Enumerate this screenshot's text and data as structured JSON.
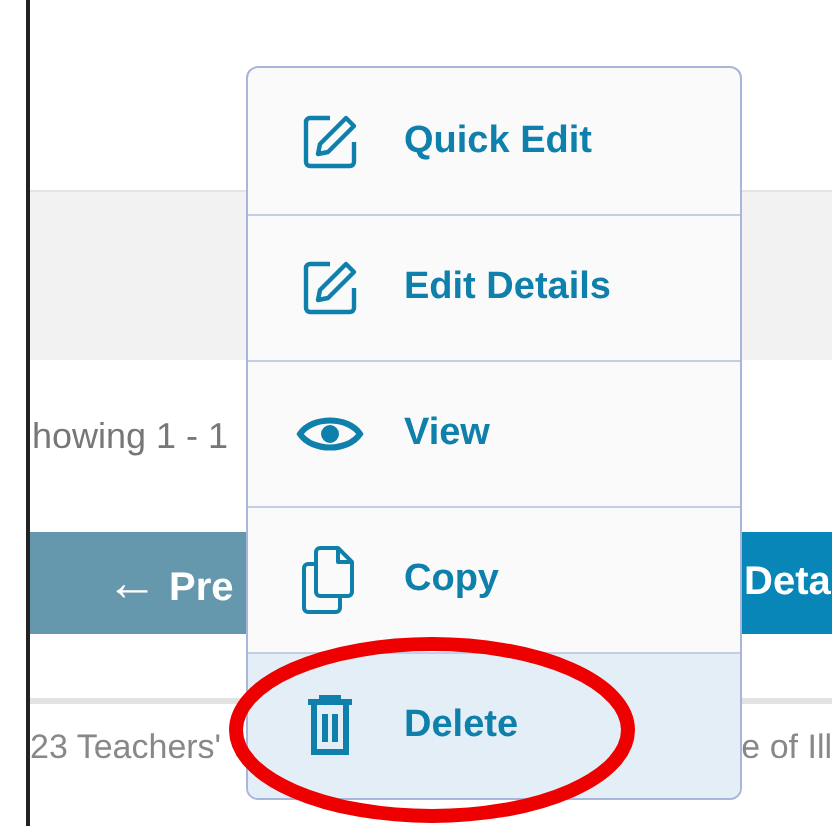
{
  "results_text": "howing 1 - 1",
  "previous_button": {
    "arrow": "←",
    "label": "Pre"
  },
  "details_button": {
    "label": "Deta"
  },
  "row": {
    "cell_1": "23 Teachers'",
    "cell_2": "e of Ill"
  },
  "menu": [
    {
      "kind": "edit",
      "label": "Quick Edit",
      "selected": false
    },
    {
      "kind": "edit",
      "label": "Edit Details",
      "selected": false
    },
    {
      "kind": "view",
      "label": "View",
      "selected": false
    },
    {
      "kind": "copy",
      "label": "Copy",
      "selected": false
    },
    {
      "kind": "delete",
      "label": "Delete",
      "selected": true
    }
  ]
}
